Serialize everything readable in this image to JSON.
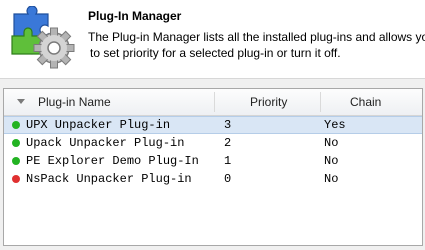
{
  "header": {
    "title": "Plug-In Manager",
    "description_line1": "The Plug-in Manager lists all the installed plug-ins and allows you",
    "description_line2": "to set priority for a selected plug-in or turn it off."
  },
  "columns": {
    "name": "Plug-in Name",
    "priority": "Priority",
    "chain": "Chain"
  },
  "status_colors": {
    "enabled": "#22b322",
    "disabled": "#e03030"
  },
  "plugins": [
    {
      "name": "UPX Unpacker Plug-in",
      "priority": "3",
      "chain": "Yes",
      "status": "enabled",
      "selected": true
    },
    {
      "name": "Upack Unpacker Plug-in",
      "priority": "2",
      "chain": "No",
      "status": "enabled",
      "selected": false
    },
    {
      "name": "PE Explorer Demo Plug-In",
      "priority": "1",
      "chain": "No",
      "status": "enabled",
      "selected": false
    },
    {
      "name": "NsPack Unpacker Plug-in",
      "priority": "0",
      "chain": "No",
      "status": "disabled",
      "selected": false
    }
  ]
}
